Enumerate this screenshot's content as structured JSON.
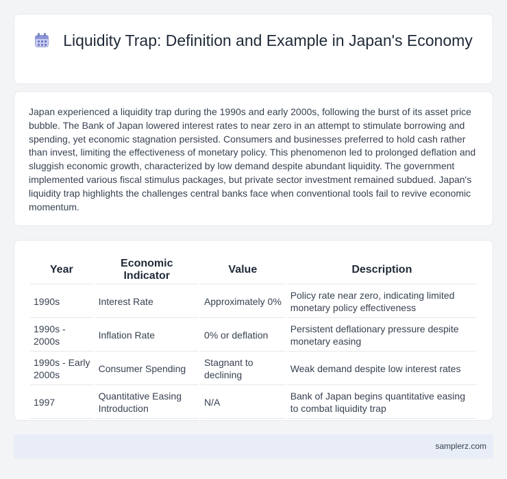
{
  "header": {
    "icon": "calendar-icon",
    "title": "Liquidity Trap: Definition and Example in Japan's Economy"
  },
  "intro": {
    "text": "Japan experienced a liquidity trap during the 1990s and early 2000s, following the burst of its asset price bubble. The Bank of Japan lowered interest rates to near zero in an attempt to stimulate borrowing and spending, yet economic stagnation persisted. Consumers and businesses preferred to hold cash rather than invest, limiting the effectiveness of monetary policy. This phenomenon led to prolonged deflation and sluggish economic growth, characterized by low demand despite abundant liquidity. The government implemented various fiscal stimulus packages, but private sector investment remained subdued. Japan's liquidity trap highlights the challenges central banks face when conventional tools fail to revive economic momentum."
  },
  "table": {
    "headers": [
      "Year",
      "Economic Indicator",
      "Value",
      "Description"
    ],
    "rows": [
      [
        "1990s",
        "Interest Rate",
        "Approximately 0%",
        "Policy rate near zero, indicating limited monetary policy effectiveness"
      ],
      [
        "1990s - 2000s",
        "Inflation Rate",
        "0% or deflation",
        "Persistent deflationary pressure despite monetary easing"
      ],
      [
        "1990s - Early 2000s",
        "Consumer Spending",
        "Stagnant to declining",
        "Weak demand despite low interest rates"
      ],
      [
        "1997",
        "Quantitative Easing Introduction",
        "N/A",
        "Bank of Japan begins quantitative easing to combat liquidity trap"
      ]
    ]
  },
  "footer": {
    "site": "samplerz.com"
  }
}
